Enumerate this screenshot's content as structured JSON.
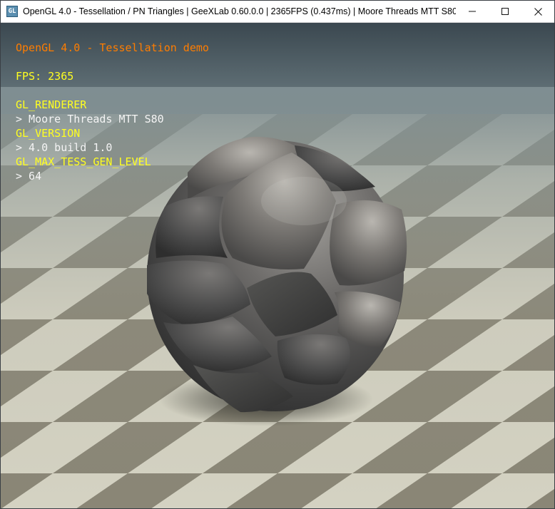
{
  "window": {
    "title": "OpenGL 4.0 - Tessellation / PN Triangles | GeeXLab 0.60.0.0 | 2365FPS (0.437ms) | Moore Threads MTT S80",
    "app_icon_glyph": "GL",
    "controls": {
      "minimize_icon": "minimize-icon",
      "maximize_icon": "maximize-icon",
      "close_icon": "close-icon"
    }
  },
  "overlay": {
    "demo_title": "OpenGL 4.0 - Tessellation demo",
    "fps": "FPS: 2365",
    "renderer_label": "GL_RENDERER",
    "renderer_value": "> Moore Threads MTT S80",
    "version_label": "GL_VERSION",
    "version_value": "> 4.0 build 1.0",
    "max_tess_label": "GL_MAX_TESS_GEN_LEVEL",
    "max_tess_value": "> 64"
  },
  "colors": {
    "demo_title": "#ff7d00",
    "labels": "#ffff20",
    "values": "#f4f4f4",
    "sky_top": "#3b4850",
    "sky_horizon": "#8a999d",
    "floor_light": "#d6d4c4",
    "floor_dark": "#8a8676",
    "object": "#5d5d5d"
  }
}
